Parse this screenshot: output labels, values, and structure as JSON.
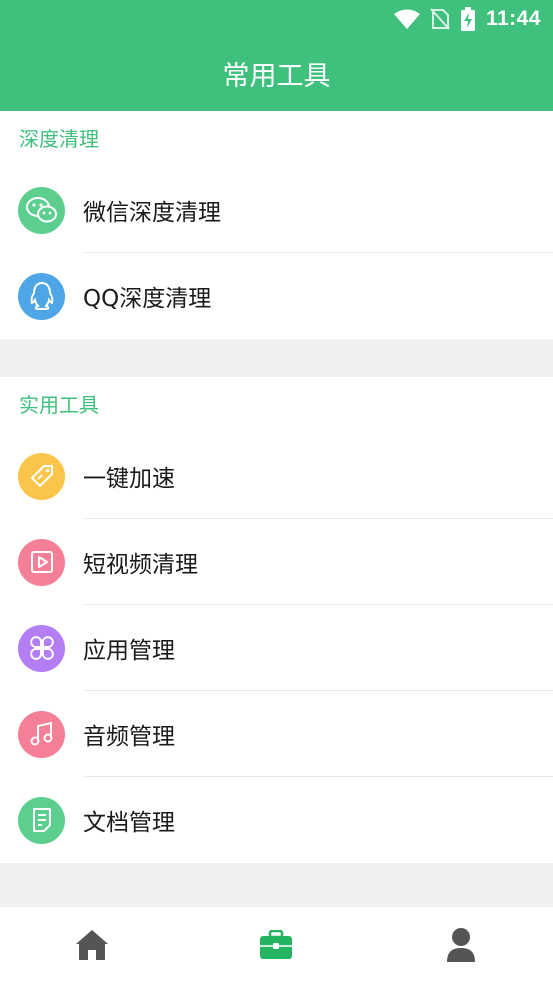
{
  "status_bar": {
    "time": "11:44"
  },
  "header": {
    "title": "常用工具"
  },
  "sections": [
    {
      "title": "深度清理",
      "items": [
        {
          "label": "微信深度清理",
          "icon": "wechat-icon",
          "color": "#5ccf8f"
        },
        {
          "label": "QQ深度清理",
          "icon": "qq-penguin-icon",
          "color": "#4ea6e6"
        }
      ]
    },
    {
      "title": "实用工具",
      "items": [
        {
          "label": "一键加速",
          "icon": "rocket-tag-icon",
          "color": "#fbc54c"
        },
        {
          "label": "短视频清理",
          "icon": "video-play-icon",
          "color": "#f47f97"
        },
        {
          "label": "应用管理",
          "icon": "app-grid-icon",
          "color": "#b37ef4"
        },
        {
          "label": "音频管理",
          "icon": "music-note-icon",
          "color": "#f47f97"
        },
        {
          "label": "文档管理",
          "icon": "document-icon",
          "color": "#5ccf8f"
        }
      ]
    }
  ],
  "tabbar": {
    "tabs": [
      {
        "name": "home",
        "icon": "home-icon",
        "active": false
      },
      {
        "name": "tools",
        "icon": "toolbox-icon",
        "active": true
      },
      {
        "name": "profile",
        "icon": "user-icon",
        "active": false
      }
    ],
    "active_color": "#24b35f",
    "inactive_color": "#555555"
  }
}
